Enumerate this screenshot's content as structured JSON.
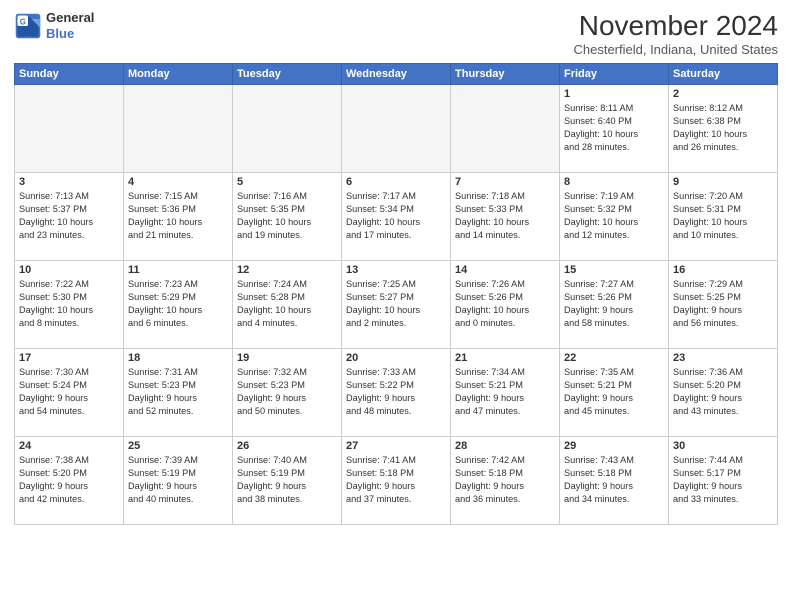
{
  "header": {
    "logo_line1": "General",
    "logo_line2": "Blue",
    "month": "November 2024",
    "location": "Chesterfield, Indiana, United States"
  },
  "weekdays": [
    "Sunday",
    "Monday",
    "Tuesday",
    "Wednesday",
    "Thursday",
    "Friday",
    "Saturday"
  ],
  "weeks": [
    [
      {
        "day": "",
        "info": "",
        "empty": true
      },
      {
        "day": "",
        "info": "",
        "empty": true
      },
      {
        "day": "",
        "info": "",
        "empty": true
      },
      {
        "day": "",
        "info": "",
        "empty": true
      },
      {
        "day": "",
        "info": "",
        "empty": true
      },
      {
        "day": "1",
        "info": "Sunrise: 8:11 AM\nSunset: 6:40 PM\nDaylight: 10 hours\nand 28 minutes.",
        "empty": false
      },
      {
        "day": "2",
        "info": "Sunrise: 8:12 AM\nSunset: 6:38 PM\nDaylight: 10 hours\nand 26 minutes.",
        "empty": false
      }
    ],
    [
      {
        "day": "3",
        "info": "Sunrise: 7:13 AM\nSunset: 5:37 PM\nDaylight: 10 hours\nand 23 minutes.",
        "empty": false
      },
      {
        "day": "4",
        "info": "Sunrise: 7:15 AM\nSunset: 5:36 PM\nDaylight: 10 hours\nand 21 minutes.",
        "empty": false
      },
      {
        "day": "5",
        "info": "Sunrise: 7:16 AM\nSunset: 5:35 PM\nDaylight: 10 hours\nand 19 minutes.",
        "empty": false
      },
      {
        "day": "6",
        "info": "Sunrise: 7:17 AM\nSunset: 5:34 PM\nDaylight: 10 hours\nand 17 minutes.",
        "empty": false
      },
      {
        "day": "7",
        "info": "Sunrise: 7:18 AM\nSunset: 5:33 PM\nDaylight: 10 hours\nand 14 minutes.",
        "empty": false
      },
      {
        "day": "8",
        "info": "Sunrise: 7:19 AM\nSunset: 5:32 PM\nDaylight: 10 hours\nand 12 minutes.",
        "empty": false
      },
      {
        "day": "9",
        "info": "Sunrise: 7:20 AM\nSunset: 5:31 PM\nDaylight: 10 hours\nand 10 minutes.",
        "empty": false
      }
    ],
    [
      {
        "day": "10",
        "info": "Sunrise: 7:22 AM\nSunset: 5:30 PM\nDaylight: 10 hours\nand 8 minutes.",
        "empty": false
      },
      {
        "day": "11",
        "info": "Sunrise: 7:23 AM\nSunset: 5:29 PM\nDaylight: 10 hours\nand 6 minutes.",
        "empty": false
      },
      {
        "day": "12",
        "info": "Sunrise: 7:24 AM\nSunset: 5:28 PM\nDaylight: 10 hours\nand 4 minutes.",
        "empty": false
      },
      {
        "day": "13",
        "info": "Sunrise: 7:25 AM\nSunset: 5:27 PM\nDaylight: 10 hours\nand 2 minutes.",
        "empty": false
      },
      {
        "day": "14",
        "info": "Sunrise: 7:26 AM\nSunset: 5:26 PM\nDaylight: 10 hours\nand 0 minutes.",
        "empty": false
      },
      {
        "day": "15",
        "info": "Sunrise: 7:27 AM\nSunset: 5:26 PM\nDaylight: 9 hours\nand 58 minutes.",
        "empty": false
      },
      {
        "day": "16",
        "info": "Sunrise: 7:29 AM\nSunset: 5:25 PM\nDaylight: 9 hours\nand 56 minutes.",
        "empty": false
      }
    ],
    [
      {
        "day": "17",
        "info": "Sunrise: 7:30 AM\nSunset: 5:24 PM\nDaylight: 9 hours\nand 54 minutes.",
        "empty": false
      },
      {
        "day": "18",
        "info": "Sunrise: 7:31 AM\nSunset: 5:23 PM\nDaylight: 9 hours\nand 52 minutes.",
        "empty": false
      },
      {
        "day": "19",
        "info": "Sunrise: 7:32 AM\nSunset: 5:23 PM\nDaylight: 9 hours\nand 50 minutes.",
        "empty": false
      },
      {
        "day": "20",
        "info": "Sunrise: 7:33 AM\nSunset: 5:22 PM\nDaylight: 9 hours\nand 48 minutes.",
        "empty": false
      },
      {
        "day": "21",
        "info": "Sunrise: 7:34 AM\nSunset: 5:21 PM\nDaylight: 9 hours\nand 47 minutes.",
        "empty": false
      },
      {
        "day": "22",
        "info": "Sunrise: 7:35 AM\nSunset: 5:21 PM\nDaylight: 9 hours\nand 45 minutes.",
        "empty": false
      },
      {
        "day": "23",
        "info": "Sunrise: 7:36 AM\nSunset: 5:20 PM\nDaylight: 9 hours\nand 43 minutes.",
        "empty": false
      }
    ],
    [
      {
        "day": "24",
        "info": "Sunrise: 7:38 AM\nSunset: 5:20 PM\nDaylight: 9 hours\nand 42 minutes.",
        "empty": false
      },
      {
        "day": "25",
        "info": "Sunrise: 7:39 AM\nSunset: 5:19 PM\nDaylight: 9 hours\nand 40 minutes.",
        "empty": false
      },
      {
        "day": "26",
        "info": "Sunrise: 7:40 AM\nSunset: 5:19 PM\nDaylight: 9 hours\nand 38 minutes.",
        "empty": false
      },
      {
        "day": "27",
        "info": "Sunrise: 7:41 AM\nSunset: 5:18 PM\nDaylight: 9 hours\nand 37 minutes.",
        "empty": false
      },
      {
        "day": "28",
        "info": "Sunrise: 7:42 AM\nSunset: 5:18 PM\nDaylight: 9 hours\nand 36 minutes.",
        "empty": false
      },
      {
        "day": "29",
        "info": "Sunrise: 7:43 AM\nSunset: 5:18 PM\nDaylight: 9 hours\nand 34 minutes.",
        "empty": false
      },
      {
        "day": "30",
        "info": "Sunrise: 7:44 AM\nSunset: 5:17 PM\nDaylight: 9 hours\nand 33 minutes.",
        "empty": false
      }
    ]
  ]
}
